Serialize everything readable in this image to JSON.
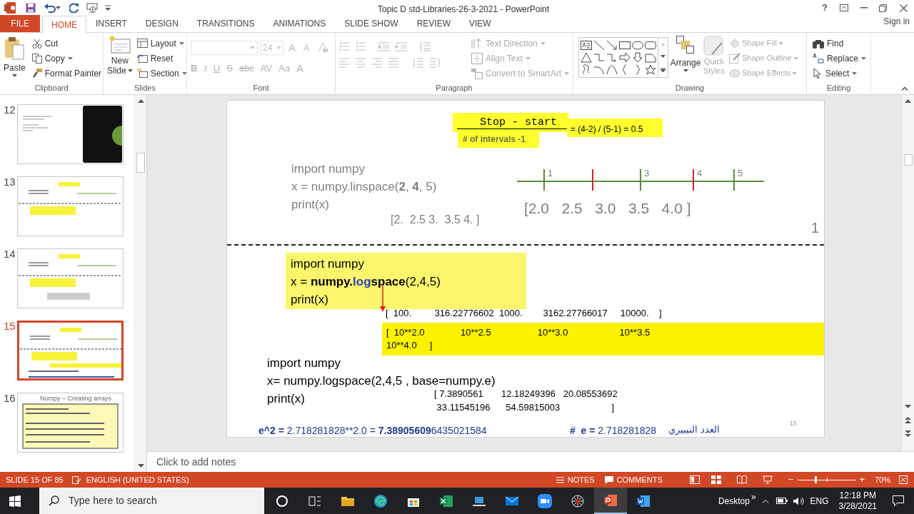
{
  "title_bar": {
    "title": "Topic D std-Libraries-26-3-2021 - PowerPoint",
    "help": "?",
    "sign_in": "Sign in"
  },
  "tabs": [
    {
      "label": "FILE",
      "kind": "file",
      "selected": false
    },
    {
      "label": "HOME",
      "kind": "tab",
      "selected": true
    },
    {
      "label": "INSERT",
      "kind": "tab",
      "selected": false
    },
    {
      "label": "DESIGN",
      "kind": "tab",
      "selected": false
    },
    {
      "label": "TRANSITIONS",
      "kind": "tab",
      "selected": false
    },
    {
      "label": "ANIMATIONS",
      "kind": "tab",
      "selected": false
    },
    {
      "label": "SLIDE SHOW",
      "kind": "tab",
      "selected": false
    },
    {
      "label": "REVIEW",
      "kind": "tab",
      "selected": false
    },
    {
      "label": "VIEW",
      "kind": "tab",
      "selected": false
    }
  ],
  "ribbon": {
    "clipboard": {
      "label": "Clipboard",
      "paste": "Paste",
      "items": [
        {
          "label": "Cut",
          "disabled": false
        },
        {
          "label": "Copy",
          "disabled": false
        },
        {
          "label": "Format Painter",
          "disabled": false
        }
      ]
    },
    "slides": {
      "label": "Slides",
      "new_slide": [
        "New",
        "Slide"
      ],
      "items": [
        {
          "label": "Layout",
          "disabled": false
        },
        {
          "label": "Reset",
          "disabled": false
        },
        {
          "label": "Section",
          "disabled": false
        }
      ]
    },
    "font": {
      "label": "Font",
      "size": "24",
      "disabled": true,
      "sizing": [
        "A",
        "A"
      ],
      "format": [
        "B",
        "I",
        "U",
        "S",
        "abc",
        "AV",
        "Aa",
        "A"
      ]
    },
    "paragraph": {
      "label": "Paragraph",
      "items": [
        {
          "label": "Text Direction",
          "disabled": true
        },
        {
          "label": "Align Text",
          "disabled": true
        },
        {
          "label": "Convert to SmartArt",
          "disabled": true
        }
      ]
    },
    "drawing": {
      "label": "Drawing",
      "arrange": "Arrange",
      "quick_styles": {
        "lines": [
          "Quick",
          "Styles"
        ],
        "disabled": true
      },
      "items": [
        {
          "label": "Shape Fill",
          "disabled": true
        },
        {
          "label": "Shape Outline",
          "disabled": true
        },
        {
          "label": "Shape Effects",
          "disabled": true
        }
      ]
    },
    "editing": {
      "label": "Editing",
      "items": [
        {
          "label": "Find",
          "disabled": false
        },
        {
          "label": "Replace",
          "disabled": false
        },
        {
          "label": "Select",
          "disabled": false
        }
      ]
    }
  },
  "thumbnails": [
    {
      "number": "12",
      "selected": false,
      "kind": "dark"
    },
    {
      "number": "13",
      "selected": false,
      "kind": "plain"
    },
    {
      "number": "14",
      "selected": false,
      "kind": "plain"
    },
    {
      "number": "15",
      "selected": true,
      "kind": "plain"
    },
    {
      "number": "16",
      "selected": false,
      "kind": "titled",
      "title": "Numpy – Creating arrays"
    }
  ],
  "slide": {
    "formula": {
      "numerator": "Stop - start",
      "denominator": "# of intervals -1",
      "result": "= (4-2) / (5-1) = 0.5"
    },
    "linspace": {
      "lines": [
        [
          {
            "text": "import numpy"
          }
        ],
        [
          {
            "text": "x = numpy.linspace("
          },
          {
            "text": "2",
            "bold": true
          },
          {
            "text": ", "
          },
          {
            "text": "4",
            "bold": true
          },
          {
            "text": ", 5)"
          }
        ],
        [
          {
            "text": "print(x)"
          }
        ]
      ],
      "output": "[2.  2.5 3.  3.5 4. ]"
    },
    "number_line": {
      "ticks": [
        {
          "label": "1",
          "color": "#5b8c3a"
        },
        {
          "color": "#d0202a"
        },
        {
          "label": "3",
          "color": "#5b8c3a"
        },
        {
          "label": "4",
          "color": "#d0202a"
        },
        {
          "label": "5",
          "color": "#5b8c3a"
        }
      ],
      "values": "[2.0   2.5   3.0   3.5   4.0 ]"
    },
    "page_mark": "1",
    "logspace": {
      "lines": [
        [
          {
            "text": "import numpy"
          }
        ],
        [
          {
            "text": "x = "
          },
          {
            "text": "numpy.",
            "bold": true
          },
          {
            "text": "log",
            "bold": true,
            "color": "#2a3fb8"
          },
          {
            "text": "space",
            "bold": true
          },
          {
            "text": "(2,4,5)"
          }
        ],
        [
          {
            "text": "print(x)"
          }
        ]
      ],
      "output": "[  100.         316.22776602  1000.        3162.27766017     10000.    ]",
      "expansion": [
        "[  10**2.0              10**2.5                  10**3.0                    10**3.5",
        "10**4.0     ]"
      ]
    },
    "logspace_e": {
      "lines": [
        [
          {
            "text": "import numpy"
          }
        ],
        [
          {
            "text": "x= numpy.logspace(2,4,5 , base=numpy.e)"
          }
        ],
        [
          {
            "text": "print(x)"
          }
        ]
      ],
      "output": [
        "[ 7.3890561       12.18249396   20.08553692",
        " 33.11545196      54.59815003                    ]"
      ]
    },
    "note_e2": [
      {
        "text": "e^2 = ",
        "bold": true
      },
      {
        "text": "2.718281828**2.0 = "
      },
      {
        "text": "7.38905609",
        "bold": true
      },
      {
        "text": "6435021584"
      }
    ],
    "note_e": [
      {
        "text": "#  e = ",
        "bold": true
      },
      {
        "text": "2.718281828"
      }
    ],
    "note_arabic": "العدد النيبيري",
    "slide_number": "15"
  },
  "notes": {
    "placeholder": "Click to add notes"
  },
  "status_bar": {
    "slide": "SLIDE 15 OF 85",
    "language": "ENGLISH (UNITED STATES)",
    "notes": "NOTES",
    "comments": "COMMENTS",
    "zoom_out": "−",
    "zoom_in": "+",
    "zoom": "70%",
    "zoom_slider": {
      "level": 0.3
    }
  },
  "taskbar": {
    "search_placeholder": "Type here to search",
    "desktop": "Desktop",
    "more": "»",
    "language": "ENG",
    "time": "12:18 PM",
    "date": "3/28/2021"
  }
}
